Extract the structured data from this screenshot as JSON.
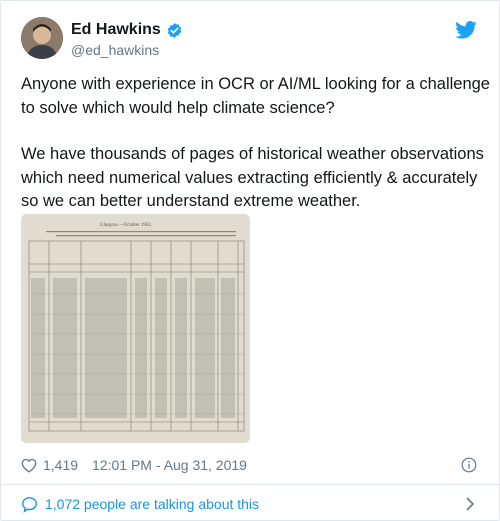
{
  "author": {
    "name": "Ed Hawkins",
    "handle": "@ed_hawkins",
    "verified": true
  },
  "tweet": {
    "paragraph_1": "Anyone with experience in OCR or AI/ML looking for a challenge to solve which would help climate science?",
    "paragraph_2": "We have thousands of pages of historical weather observations which need numerical values extracting efficiently & accurately so we can better understand extreme weather."
  },
  "media": {
    "heading": "Glasgow.—October 1902."
  },
  "meta": {
    "like_count": "1,419",
    "timestamp": "12:01 PM - Aug 31, 2019"
  },
  "discussion": {
    "label": "1,072 people are talking about this"
  },
  "colors": {
    "link": "#1b95e0",
    "muted": "#657786",
    "twitter_blue": "#1da1f2"
  },
  "icons": [
    "verified-badge-icon",
    "twitter-bird-icon",
    "heart-icon",
    "info-icon",
    "comment-bubble-icon",
    "chevron-right-icon"
  ]
}
